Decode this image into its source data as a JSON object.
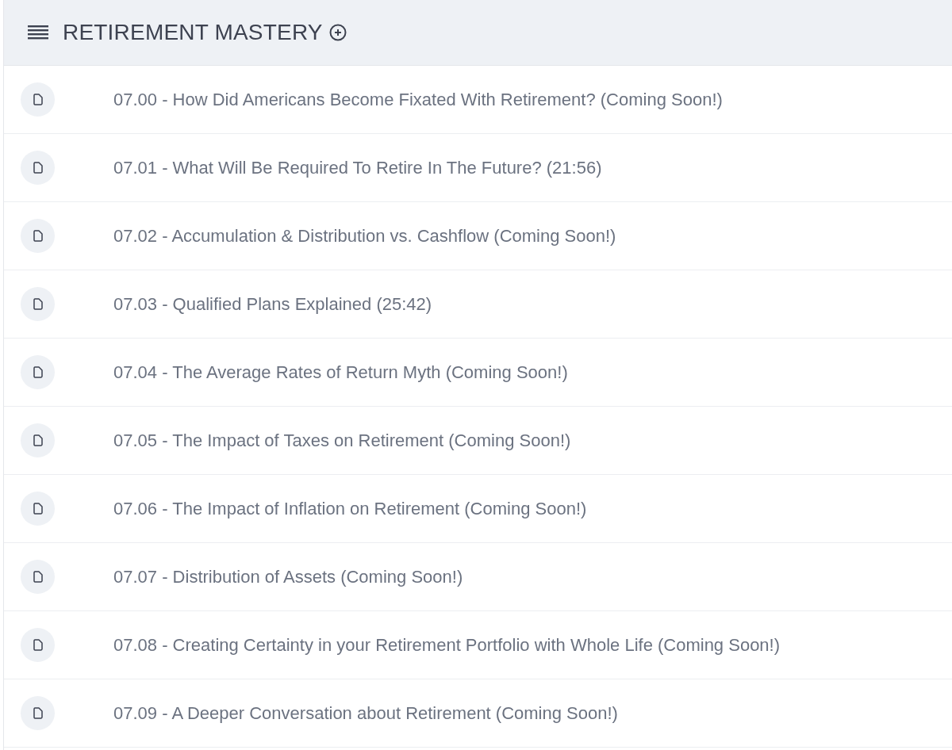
{
  "header": {
    "title": "RETIREMENT MASTERY"
  },
  "lessons": [
    {
      "title": "07.00 - How Did Americans Become Fixated With Retirement? (Coming Soon!)"
    },
    {
      "title": "07.01 - What Will Be Required To Retire In The Future? (21:56)"
    },
    {
      "title": "07.02 - Accumulation & Distribution vs. Cashflow (Coming Soon!)"
    },
    {
      "title": "07.03 - Qualified Plans Explained (25:42)"
    },
    {
      "title": "07.04 - The Average Rates of Return Myth (Coming Soon!)"
    },
    {
      "title": "07.05 - The Impact of Taxes on Retirement (Coming Soon!)"
    },
    {
      "title": "07.06 - The Impact of Inflation on Retirement (Coming Soon!)"
    },
    {
      "title": "07.07 - Distribution of Assets (Coming Soon!)"
    },
    {
      "title": "07.08 - Creating Certainty in your Retirement Portfolio with Whole Life (Coming Soon!)"
    },
    {
      "title": "07.09 - A Deeper Conversation about Retirement (Coming Soon!)"
    }
  ]
}
